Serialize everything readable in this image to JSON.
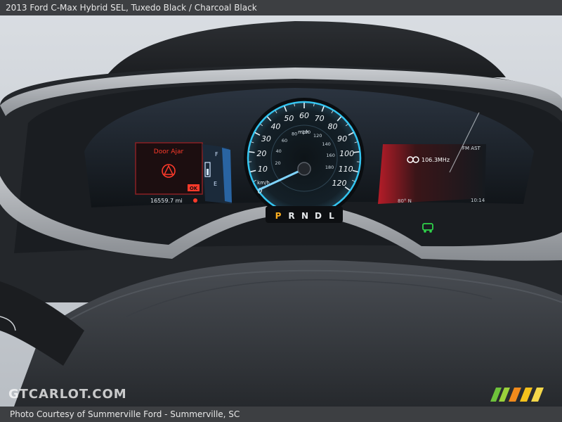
{
  "caption": {
    "title": "2013 Ford C-Max Hybrid SEL,  Tuxedo Black / Charcoal Black",
    "credit": "Photo Courtesy of Summerville Ford - Summerville, SC"
  },
  "watermark": {
    "text": "GTCARLOT.COM"
  },
  "cluster": {
    "left_display": {
      "warning_title": "Door Ajar",
      "ok_label": "OK",
      "odometer": "16559.7 mi",
      "gauge_full": "F",
      "gauge_empty": "E"
    },
    "speedometer": {
      "mph_ticks": [
        "10",
        "20",
        "30",
        "40",
        "50",
        "60",
        "70",
        "80",
        "90",
        "100",
        "110",
        "120"
      ],
      "mph_unit": "mph",
      "kmh_ticks": [
        "20",
        "40",
        "60",
        "80",
        "100",
        "120",
        "140",
        "160",
        "180"
      ],
      "kmh_unit": "km/h",
      "zero": "0",
      "speed_mph": 0
    },
    "gear": {
      "positions": [
        "P",
        "R",
        "N",
        "D",
        "L"
      ],
      "selected": "P"
    },
    "right_display": {
      "band": "FM AST",
      "frequency": "106.3MHz",
      "temperature": "80° N",
      "clock": "10:14"
    }
  },
  "colors": {
    "gauge_ring": "#33c4f0",
    "warning": "#ff3a2a",
    "selected_gear": "#ffb020",
    "indicator": "#2fd24a"
  }
}
